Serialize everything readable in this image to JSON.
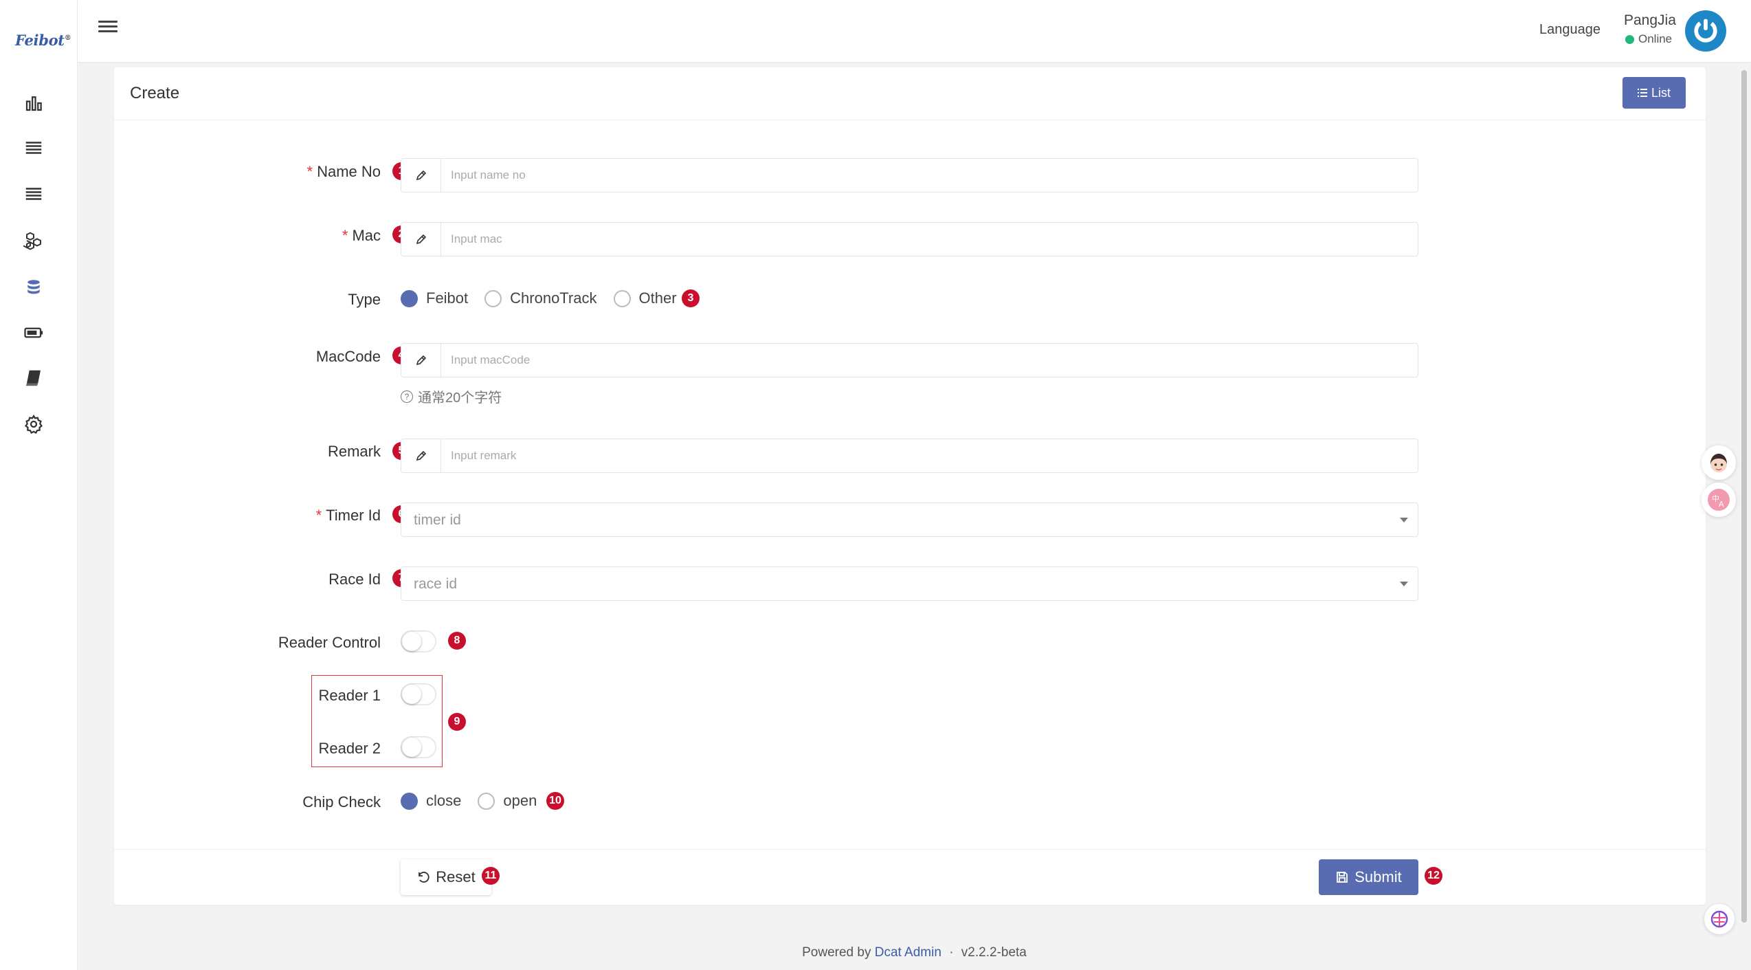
{
  "app": {
    "logo_text": "Feibot",
    "logo_mark": "®",
    "language_label": "Language",
    "user_name": "PangJia",
    "user_status": "Online"
  },
  "sidebar": {
    "icons": [
      "bar-chart-icon",
      "list-icon",
      "list-icon",
      "cubes-icon",
      "database-icon",
      "battery-icon",
      "book-icon",
      "gear-icon"
    ],
    "active_index": 4
  },
  "card": {
    "title": "Create",
    "list_button": "List"
  },
  "form": {
    "name_no": {
      "label": "Name No",
      "placeholder": "Input name no",
      "required": true,
      "badge": "1"
    },
    "mac": {
      "label": "Mac",
      "placeholder": "Input mac",
      "required": true,
      "badge": "2"
    },
    "type": {
      "label": "Type",
      "options": [
        "Feibot",
        "ChronoTrack",
        "Other"
      ],
      "selected": "Feibot",
      "badge": "3"
    },
    "mac_code": {
      "label": "MacCode",
      "placeholder": "Input macCode",
      "help": "通常20个字符",
      "badge": "4"
    },
    "remark": {
      "label": "Remark",
      "placeholder": "Input remark",
      "badge": "5"
    },
    "timer_id": {
      "label": "Timer Id",
      "placeholder": "timer id",
      "required": true,
      "badge": "6"
    },
    "race_id": {
      "label": "Race Id",
      "placeholder": "race id",
      "badge": "7"
    },
    "reader_control": {
      "label": "Reader Control",
      "on": false,
      "badge": "8"
    },
    "reader_1": {
      "label": "Reader 1",
      "on": false
    },
    "reader_2": {
      "label": "Reader 2",
      "on": false
    },
    "readers_badge": "9",
    "chip_check": {
      "label": "Chip Check",
      "options": [
        "close",
        "open"
      ],
      "selected": "close",
      "badge": "10"
    },
    "reset_button": "Reset",
    "reset_badge": "11",
    "submit_button": "Submit",
    "submit_badge": "12"
  },
  "footer": {
    "powered_by": "Powered by",
    "link_text": "Dcat Admin",
    "separator": "·",
    "version": "v2.2.2-beta"
  },
  "colors": {
    "primary": "#586cb1",
    "required": "#e5353b",
    "badge": "#c8102e",
    "online": "#21b978",
    "avatar": "#1e88c7"
  }
}
